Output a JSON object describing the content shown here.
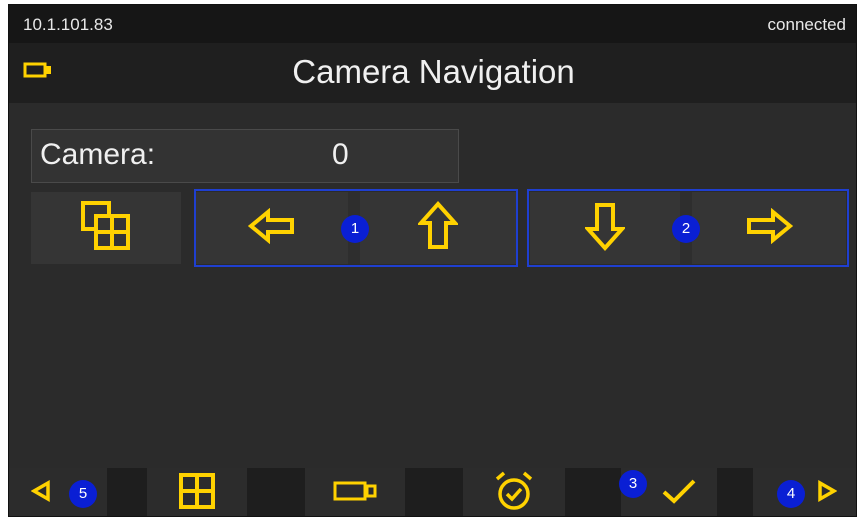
{
  "status": {
    "ip": "10.1.101.83",
    "connection": "connected"
  },
  "header": {
    "title": "Camera Navigation",
    "icon": "camera-icon"
  },
  "camera": {
    "label": "Camera:",
    "value": "0"
  },
  "controls": {
    "multiview_icon": "multiview-icon",
    "group1": {
      "badge": "1",
      "items": [
        "arrow-left-icon",
        "arrow-up-icon"
      ]
    },
    "group2": {
      "badge": "2",
      "items": [
        "arrow-down-icon",
        "arrow-right-icon"
      ]
    }
  },
  "bottom_nav": {
    "items": [
      {
        "icon": "triangle-left-icon",
        "badge": "5"
      },
      {
        "icon": "grid-icon"
      },
      {
        "icon": "camera-icon"
      },
      {
        "icon": "alarm-clock-icon"
      },
      {
        "icon": "checkmark-icon",
        "badge": "3"
      },
      {
        "icon": "triangle-right-icon",
        "badge": "4"
      }
    ]
  },
  "colors": {
    "accent": "#ffd200",
    "badge": "#0a1fd4",
    "outline": "#1f3fd0",
    "background": "#2b2b2b"
  }
}
